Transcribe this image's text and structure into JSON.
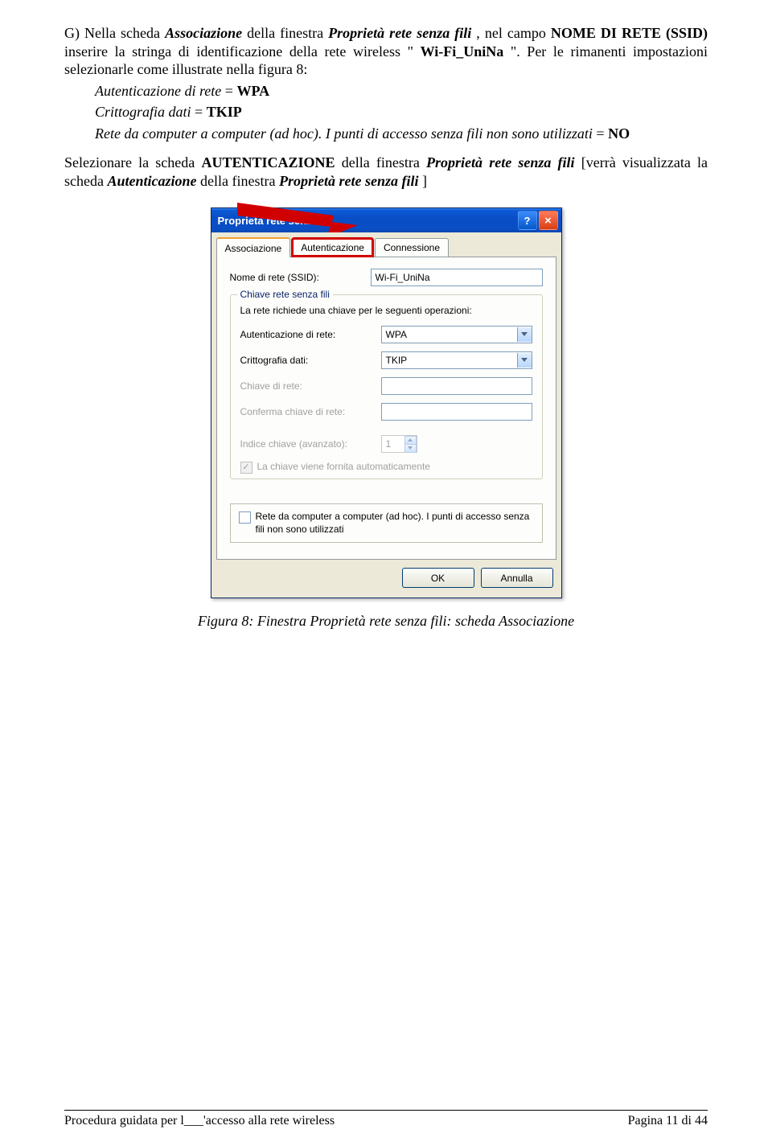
{
  "para": {
    "g": "G) Nella scheda ",
    "assoc": "Associazione",
    "g2": " della finestra ",
    "prop": "Proprietà rete senza fili",
    "g3": ", nel campo ",
    "field": "NOME DI RETE (SSID)",
    "g4": " inserire la stringa di identificazione della rete wireless \"",
    "ssid": "Wi-Fi_UniNa",
    "g5": "\". Per le rimanenti impostazioni selezionarle come illustrate nella figura 8:",
    "l1a": "Autenticazione di rete",
    "l1b": " = ",
    "l1c": "WPA",
    "l2a": "Crittografia dati",
    "l2b": " = ",
    "l2c": "TKIP",
    "l3a": "Rete da computer a computer (ad hoc). I punti di accesso senza fili non sono utilizzati",
    "l3b": " = ",
    "l3c": "NO",
    "p2a": "Selezionare la scheda ",
    "p2b": "AUTENTICAZIONE",
    "p2c": " della finestra ",
    "p2d": "Proprietà rete senza fili",
    "p2e": " [verrà visualizzata la scheda ",
    "p2f": "Autenticazione",
    "p2g": " della finestra ",
    "p2h": "Proprietà rete senza fili",
    "p2i": "]"
  },
  "dialog": {
    "title": "Proprietà rete senza fili",
    "tabs": {
      "associazione": "Associazione",
      "autenticazione": "Autenticazione",
      "connessione": "Connessione"
    },
    "ssid_label": "Nome di rete (SSID):",
    "ssid_value": "Wi-Fi_UniNa",
    "group_legend": "Chiave rete senza fili",
    "group_text": "La rete richiede una chiave per le seguenti operazioni:",
    "auth_label": "Autenticazione di rete:",
    "auth_value": "WPA",
    "crypt_label": "Crittografia dati:",
    "crypt_value": "TKIP",
    "key_label": "Chiave di rete:",
    "key2_label": "Conferma chiave di rete:",
    "index_label": "Indice chiave (avanzato):",
    "index_value": "1",
    "autokey_label": "La chiave viene fornita automaticamente",
    "adhoc_label": "Rete da computer a computer (ad hoc). I punti di accesso senza fili non sono utilizzati",
    "ok": "OK",
    "cancel": "Annulla"
  },
  "caption": "Figura 8: Finestra Proprietà rete senza fili: scheda Associazione",
  "footer": {
    "left": "Procedura guidata per l___'accesso alla rete wireless",
    "right": "Pagina 11 di 44"
  }
}
